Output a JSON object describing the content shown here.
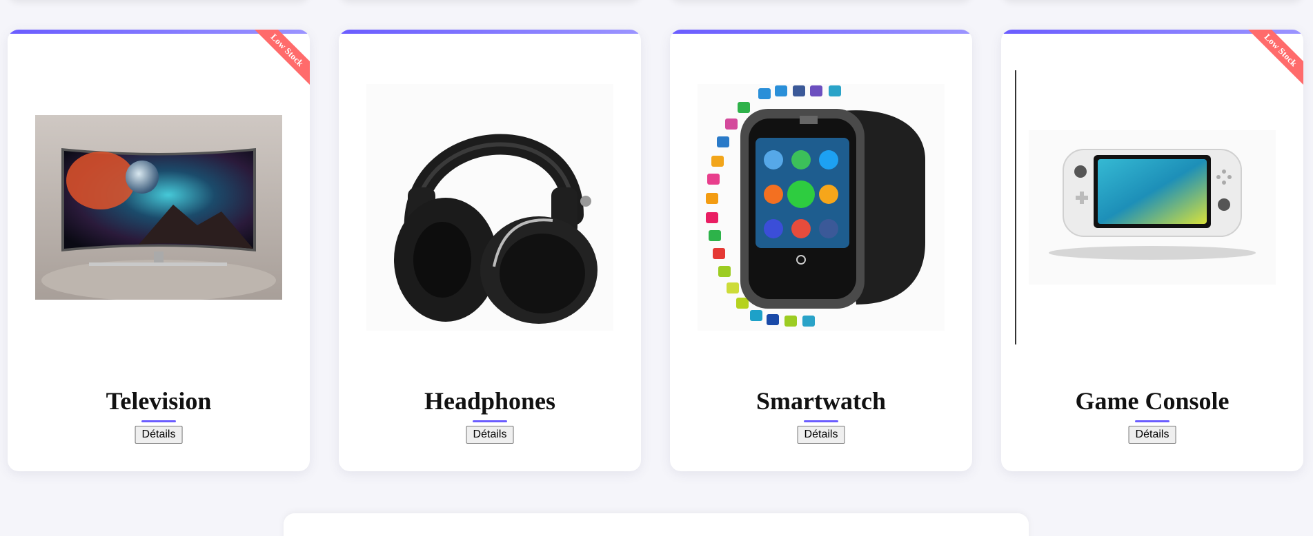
{
  "products": [
    {
      "name": "Television",
      "button_label": "Détails",
      "badge": "Low Stock",
      "icon": "television-image"
    },
    {
      "name": "Headphones",
      "button_label": "Détails",
      "badge": "",
      "icon": "headphones-image"
    },
    {
      "name": "Smartwatch",
      "button_label": "Détails",
      "badge": "",
      "icon": "smartwatch-image"
    },
    {
      "name": "Game Console",
      "button_label": "Détails",
      "badge": "Low Stock",
      "icon": "game-console-image"
    }
  ],
  "colors": {
    "accent": "#6a5cff",
    "badge": "#ff6b6b"
  }
}
